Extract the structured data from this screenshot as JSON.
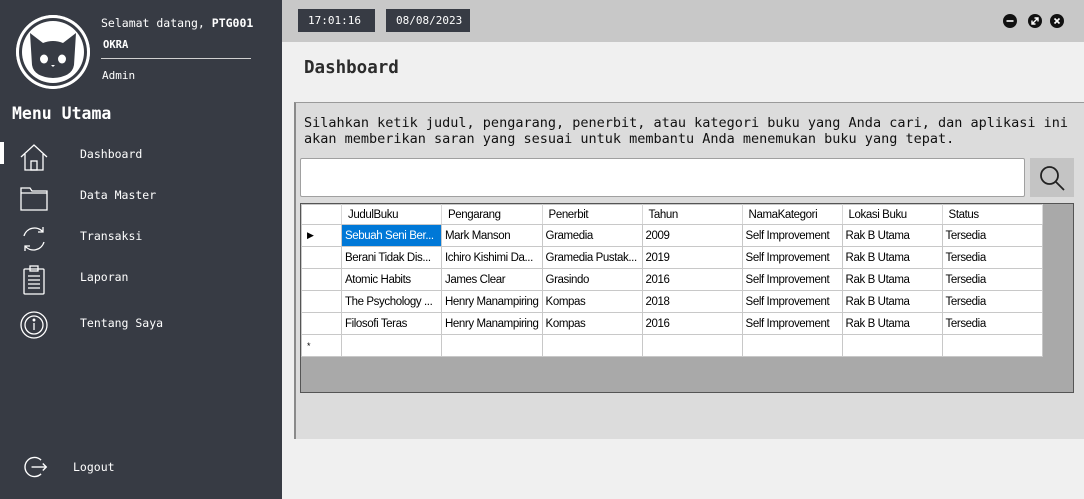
{
  "user": {
    "welcome_prefix": "Selamat datang, ",
    "id": "PTG001",
    "name": "OKRA",
    "role": "Admin"
  },
  "menu": {
    "title": "Menu Utama",
    "items": [
      {
        "label": "Dashboard",
        "icon": "home-icon",
        "active": true
      },
      {
        "label": "Data Master",
        "icon": "folder-icon"
      },
      {
        "label": "Transaksi",
        "icon": "sync-icon"
      },
      {
        "label": "Laporan",
        "icon": "clipboard-icon"
      },
      {
        "label": "Tentang Saya",
        "icon": "info-icon"
      }
    ],
    "logout": "Logout"
  },
  "topbar": {
    "time": "17:01:16",
    "date": "08/08/2023"
  },
  "page": {
    "title": "Dashboard",
    "instruction": "Silahkan ketik judul, pengarang, penerbit, atau kategori buku yang Anda cari, dan aplikasi ini\nakan memberikan saran yang sesuai untuk membantu Anda menemukan buku yang tepat.",
    "search_value": ""
  },
  "grid": {
    "columns": [
      "JudulBuku",
      "Pengarang",
      "Penerbit",
      "Tahun",
      "NamaKategori",
      "Lokasi Buku",
      "Status"
    ],
    "rows": [
      [
        "Sebuah Seni Ber...",
        "Mark Manson",
        "Gramedia",
        "2009",
        "Self Improvement",
        "Rak B Utama",
        "Tersedia"
      ],
      [
        "Berani Tidak Dis...",
        "Ichiro Kishimi Da...",
        "Gramedia Pustak...",
        "2019",
        "Self Improvement",
        "Rak B Utama",
        "Tersedia"
      ],
      [
        "Atomic Habits",
        "James Clear",
        "Grasindo",
        "2016",
        "Self Improvement",
        "Rak B Utama",
        "Tersedia"
      ],
      [
        "The Psychology ...",
        "Henry Manampiring",
        "Kompas",
        "2018",
        "Self Improvement",
        "Rak B Utama",
        "Tersedia"
      ],
      [
        "Filosofi Teras",
        "Henry Manampiring",
        "Kompas",
        "2016",
        "Self Improvement",
        "Rak B Utama",
        "Tersedia"
      ]
    ],
    "current_row_marker": "▶",
    "new_row_marker": "*"
  },
  "colors": {
    "sidebar": "#373b44",
    "selection": "#0078d7",
    "topbar": "#c8c8c8"
  }
}
